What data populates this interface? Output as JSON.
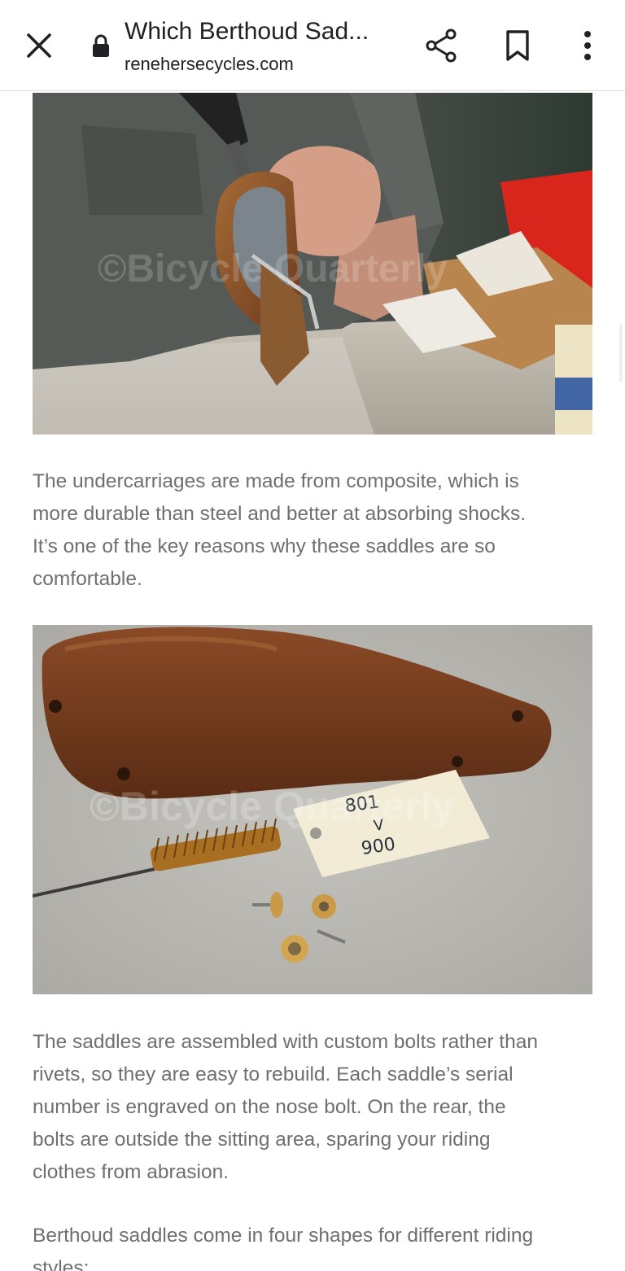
{
  "browser": {
    "page_title": "Which Berthoud Sad...",
    "domain": "renehersecycles.com",
    "icons": {
      "close": "close-icon",
      "lock": "lock-icon",
      "share": "share-icon",
      "bookmark": "bookmark-icon",
      "more": "more-vert-icon"
    }
  },
  "article": {
    "paragraph_1": [
      "The undercarriages are made from composite, which is",
      "more durable than steel and better at absorbing shocks.",
      "It’s one of the key reasons why these saddles are so",
      "comfortable."
    ],
    "paragraph_2": [
      "The saddles are assembled with custom bolts rather than",
      "rivets, so they are easy to rebuild. Each saddle’s serial",
      "number is engraved on the nose bolt. On the rear, the",
      "bolts are outside the sitting area, sparing your riding",
      "clothes from abrasion."
    ],
    "paragraph_3": [
      "Berthoud saddles come in four shapes for different riding",
      "styles:"
    ],
    "image_1": {
      "watermark": "©Bicycle Quarterly"
    },
    "image_2": {
      "watermark": "©Bicycle Quarterly",
      "tag_line_1": "801",
      "tag_line_2": "V",
      "tag_line_3": "900"
    }
  },
  "colors": {
    "toolbar_bg": "#ffffff",
    "toolbar_text": "#202124",
    "body_text": "#6f6f6f",
    "saddle_leather": "#6b3a1f"
  }
}
